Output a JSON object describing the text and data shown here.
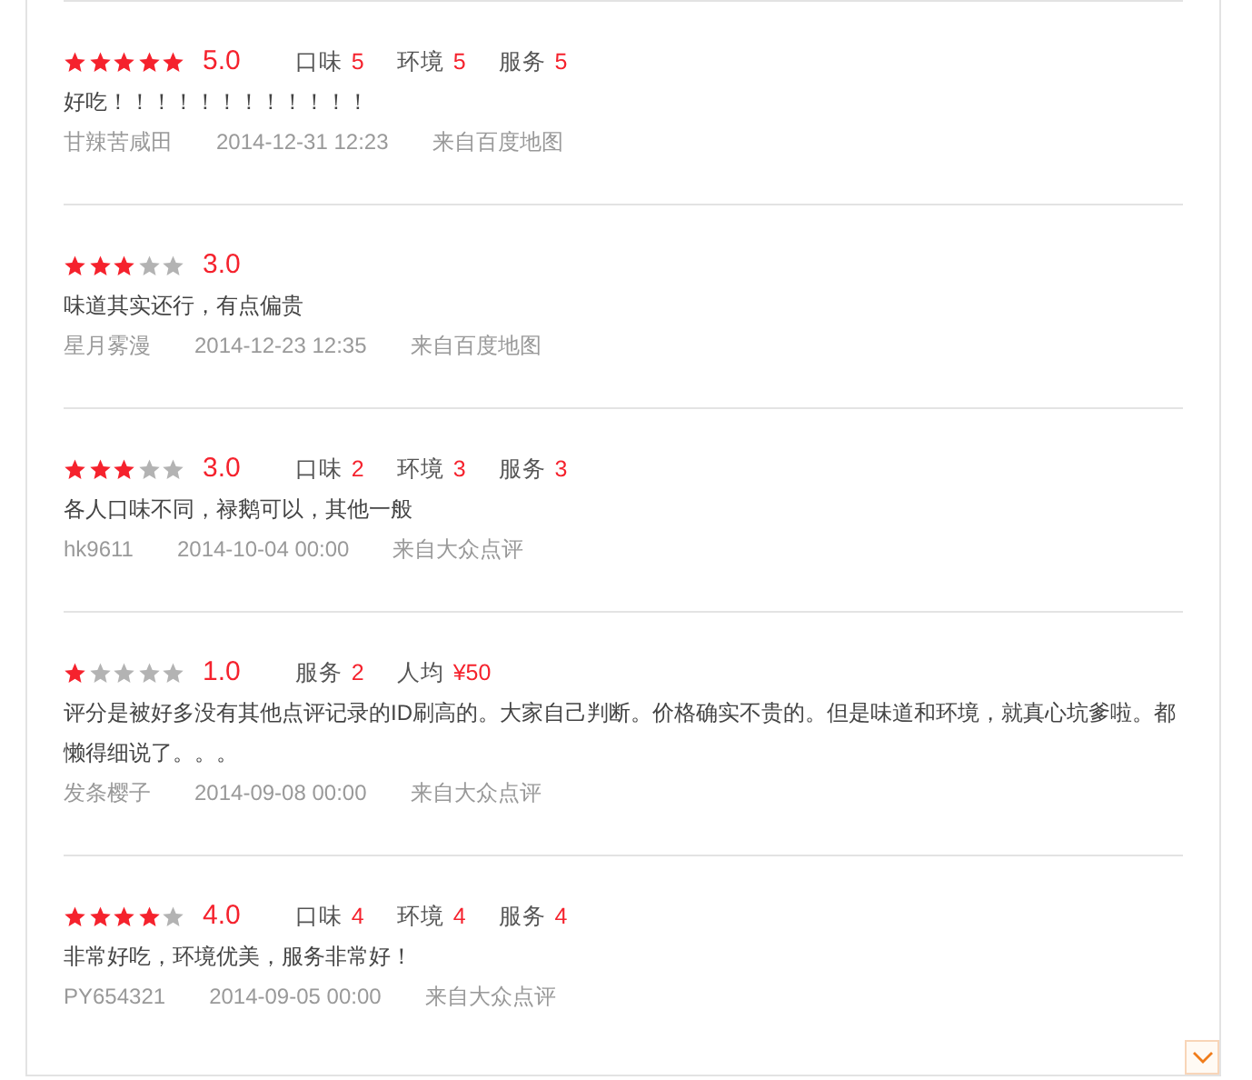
{
  "reviews": [
    {
      "stars": 5,
      "score": "5.0",
      "subscores": [
        {
          "label": "口味",
          "value": "5"
        },
        {
          "label": "环境",
          "value": "5"
        },
        {
          "label": "服务",
          "value": "5"
        }
      ],
      "text": "好吃！！！！！！！！！！！！",
      "user": "甘辣苦咸田",
      "time": "2014-12-31 12:23",
      "source": "来自百度地图"
    },
    {
      "stars": 3,
      "score": "3.0",
      "text": "味道其实还行，有点偏贵",
      "user": "星月雾漫",
      "time": "2014-12-23 12:35",
      "source": "来自百度地图"
    },
    {
      "stars": 3,
      "score": "3.0",
      "subscores": [
        {
          "label": "口味",
          "value": "2"
        },
        {
          "label": "环境",
          "value": "3"
        },
        {
          "label": "服务",
          "value": "3"
        }
      ],
      "text": "各人口味不同，禄鹅可以，其他一般",
      "user": "hk9611",
      "time": "2014-10-04 00:00",
      "source": "来自大众点评"
    },
    {
      "stars": 1,
      "score": "1.0",
      "subscores": [
        {
          "label": "服务",
          "value": "2"
        },
        {
          "label": "人均",
          "value": "¥50"
        }
      ],
      "text": "评分是被好多没有其他点评记录的ID刷高的。大家自己判断。价格确实不贵的。但是味道和环境，就真心坑爹啦。都懒得细说了。。。",
      "user": "发条樱子",
      "time": "2014-09-08 00:00",
      "source": "来自大众点评"
    },
    {
      "stars": 4,
      "score": "4.0",
      "subscores": [
        {
          "label": "口味",
          "value": "4"
        },
        {
          "label": "环境",
          "value": "4"
        },
        {
          "label": "服务",
          "value": "4"
        }
      ],
      "text": "非常好吃，环境优美，服务非常好！",
      "user": "PY654321",
      "time": "2014-09-05 00:00",
      "source": "来自大众点评"
    }
  ]
}
